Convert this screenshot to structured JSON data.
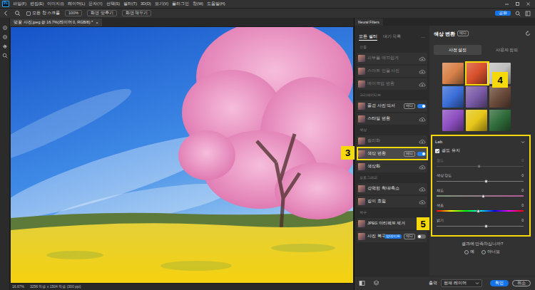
{
  "app": {
    "logo": "Ps",
    "menu": [
      "파일(F)",
      "편집(E)",
      "이미지(I)",
      "레이어(L)",
      "문자(Y)",
      "선택(S)",
      "필터(T)",
      "3D(D)",
      "보기(V)",
      "플러그인",
      "창(W)",
      "도움말(H)"
    ]
  },
  "options_bar": {
    "scroll_all": {
      "label": "모든 창 스크롤",
      "checked": false
    },
    "buttons": [
      "100%",
      "화면 맞추기",
      "화면 채우기"
    ],
    "share": "공유"
  },
  "document": {
    "tab": "벚꽃 사진.jpeg @ 16.7%(레이어 0, RGB/8) *",
    "close": "×",
    "zoom": "16.67%",
    "info": "3256 픽셀 x 1504 픽셀 (300 ppi)"
  },
  "panel": {
    "title": "Neural Filters",
    "list_tabs": [
      {
        "label": "모든 필터",
        "selected": true
      },
      {
        "label": "대기 목록",
        "selected": false
      }
    ],
    "more": "···",
    "groups": [
      {
        "title": "인물",
        "filters": [
          {
            "label": "피부를 매끄럽게",
            "kind": "download",
            "disabled": true,
            "selected": false,
            "badges": []
          },
          {
            "label": "스마트 인물 사진",
            "kind": "download",
            "disabled": true,
            "selected": false,
            "badges": []
          },
          {
            "label": "메이크업 변환",
            "kind": "download",
            "disabled": true,
            "selected": false,
            "badges": []
          }
        ]
      },
      {
        "title": "크리에이티브",
        "filters": [
          {
            "label": "풍경 사진 믹서",
            "kind": "toggle",
            "on": true,
            "disabled": false,
            "selected": false,
            "badges": [
              {
                "label": "베타",
                "kind": "beta"
              }
            ]
          },
          {
            "label": "스타일 변환",
            "kind": "download",
            "disabled": false,
            "selected": false,
            "badges": []
          }
        ]
      },
      {
        "title": "색상",
        "filters": [
          {
            "label": "컬러화",
            "kind": "download",
            "disabled": true,
            "selected": false,
            "badges": []
          },
          {
            "label": "색상 변환",
            "kind": "toggle",
            "on": true,
            "disabled": false,
            "selected": true,
            "badges": [
              {
                "label": "베타",
                "kind": "beta"
              }
            ]
          },
          {
            "label": "색상화",
            "kind": "download",
            "disabled": false,
            "selected": false,
            "badges": []
          }
        ]
      },
      {
        "title": "포토그래피",
        "filters": [
          {
            "label": "강력한 확대/축소",
            "kind": "download",
            "disabled": false,
            "selected": false,
            "badges": []
          },
          {
            "label": "깊이 흐림",
            "kind": "download",
            "disabled": false,
            "selected": false,
            "badges": []
          }
        ]
      },
      {
        "title": "복구",
        "filters": [
          {
            "label": "JPEG 아티팩트 제거",
            "kind": "download",
            "disabled": false,
            "selected": false,
            "badges": []
          },
          {
            "label": "사진 복구",
            "kind": "toggle",
            "on": false,
            "disabled": false,
            "selected": false,
            "badges": [
              {
                "label": "업데이트",
                "kind": "update"
              },
              {
                "label": "베타",
                "kind": "beta"
              }
            ]
          }
        ]
      }
    ]
  },
  "filter": {
    "title": "색상 변환",
    "badge": "베타",
    "tabs": [
      {
        "label": "사전 설정",
        "selected": true
      },
      {
        "label": "사용자 정의",
        "selected": false
      }
    ],
    "presets": [
      {
        "color": "#d9824a",
        "selected": false
      },
      {
        "color": "#d8502c",
        "selected": true
      },
      {
        "color": "#bfbfbf",
        "selected": false
      },
      {
        "color": "#3b6ed8",
        "selected": false
      },
      {
        "color": "#7a5ba8",
        "selected": false
      },
      {
        "color": "#6a4a3a",
        "selected": false
      },
      {
        "color": "#8e4fc2",
        "selected": false
      },
      {
        "color": "#e6c619",
        "selected": false
      },
      {
        "color": "#2f6b3a",
        "selected": false
      }
    ],
    "color_space": "Lab",
    "preserve": {
      "label": "광도 유지",
      "checked": true
    },
    "sliders": [
      {
        "label": "광도",
        "value": "0",
        "level": 0.49,
        "disabled": true,
        "kind": "plain"
      },
      {
        "label": "색상 강도",
        "value": "0",
        "level": 0.57,
        "disabled": false,
        "kind": "plain"
      },
      {
        "label": "채도",
        "value": "0",
        "level": 0.54,
        "disabled": false,
        "kind": "saturation"
      },
      {
        "label": "색조",
        "value": "0",
        "level": 0.48,
        "disabled": false,
        "kind": "hue"
      },
      {
        "label": "밝기",
        "value": "0",
        "level": 0.57,
        "disabled": false,
        "kind": "plain"
      }
    ],
    "question": "결과에 만족하십니까?",
    "answers": [
      {
        "label": "예",
        "selected": false
      },
      {
        "label": "아니오",
        "selected": false
      }
    ]
  },
  "footer": {
    "output_label": "출력",
    "output": "현재 레이어",
    "ok": "확인",
    "cancel": "취소"
  },
  "annotations": [
    {
      "number": "3"
    },
    {
      "number": "4"
    },
    {
      "number": "5"
    }
  ]
}
